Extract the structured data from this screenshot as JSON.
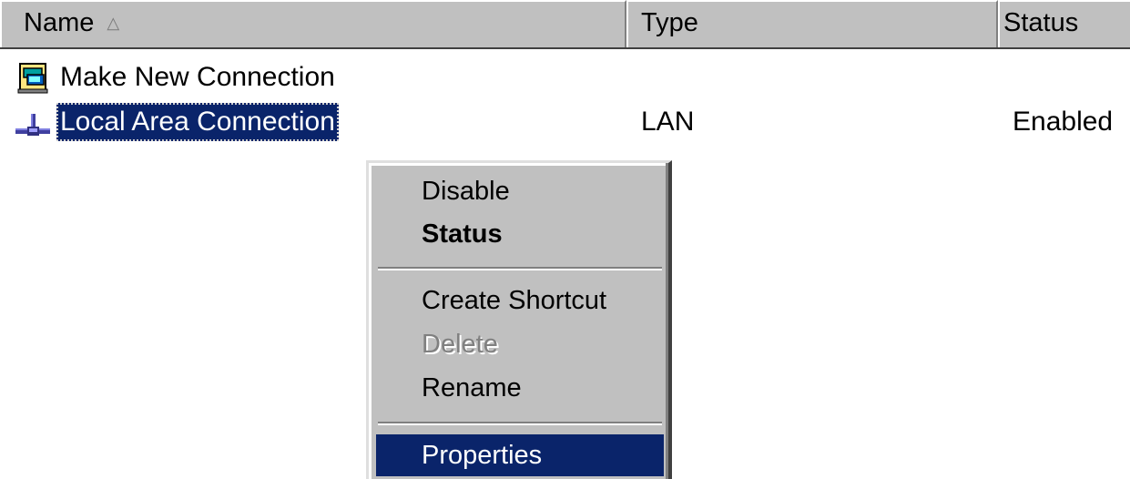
{
  "columns": {
    "name": "Name",
    "type": "Type",
    "status": "Status",
    "sort_indicator": "△"
  },
  "rows": [
    {
      "name": "Make New Connection",
      "type": "",
      "status": "",
      "icon": "wizard-icon"
    },
    {
      "name": "Local Area Connection",
      "type": "LAN",
      "status": "Enabled",
      "icon": "network-icon",
      "selected": true
    }
  ],
  "context_menu": {
    "items": [
      {
        "label": "Disable",
        "enabled": true
      },
      {
        "label": "Status",
        "enabled": true,
        "default": true
      },
      {
        "label": "Create Shortcut",
        "enabled": true
      },
      {
        "label": "Delete",
        "enabled": false
      },
      {
        "label": "Rename",
        "enabled": true
      },
      {
        "label": "Properties",
        "enabled": true,
        "highlighted": true
      }
    ]
  },
  "colors": {
    "selection": "#0a246a",
    "face": "#c0c0c0"
  }
}
